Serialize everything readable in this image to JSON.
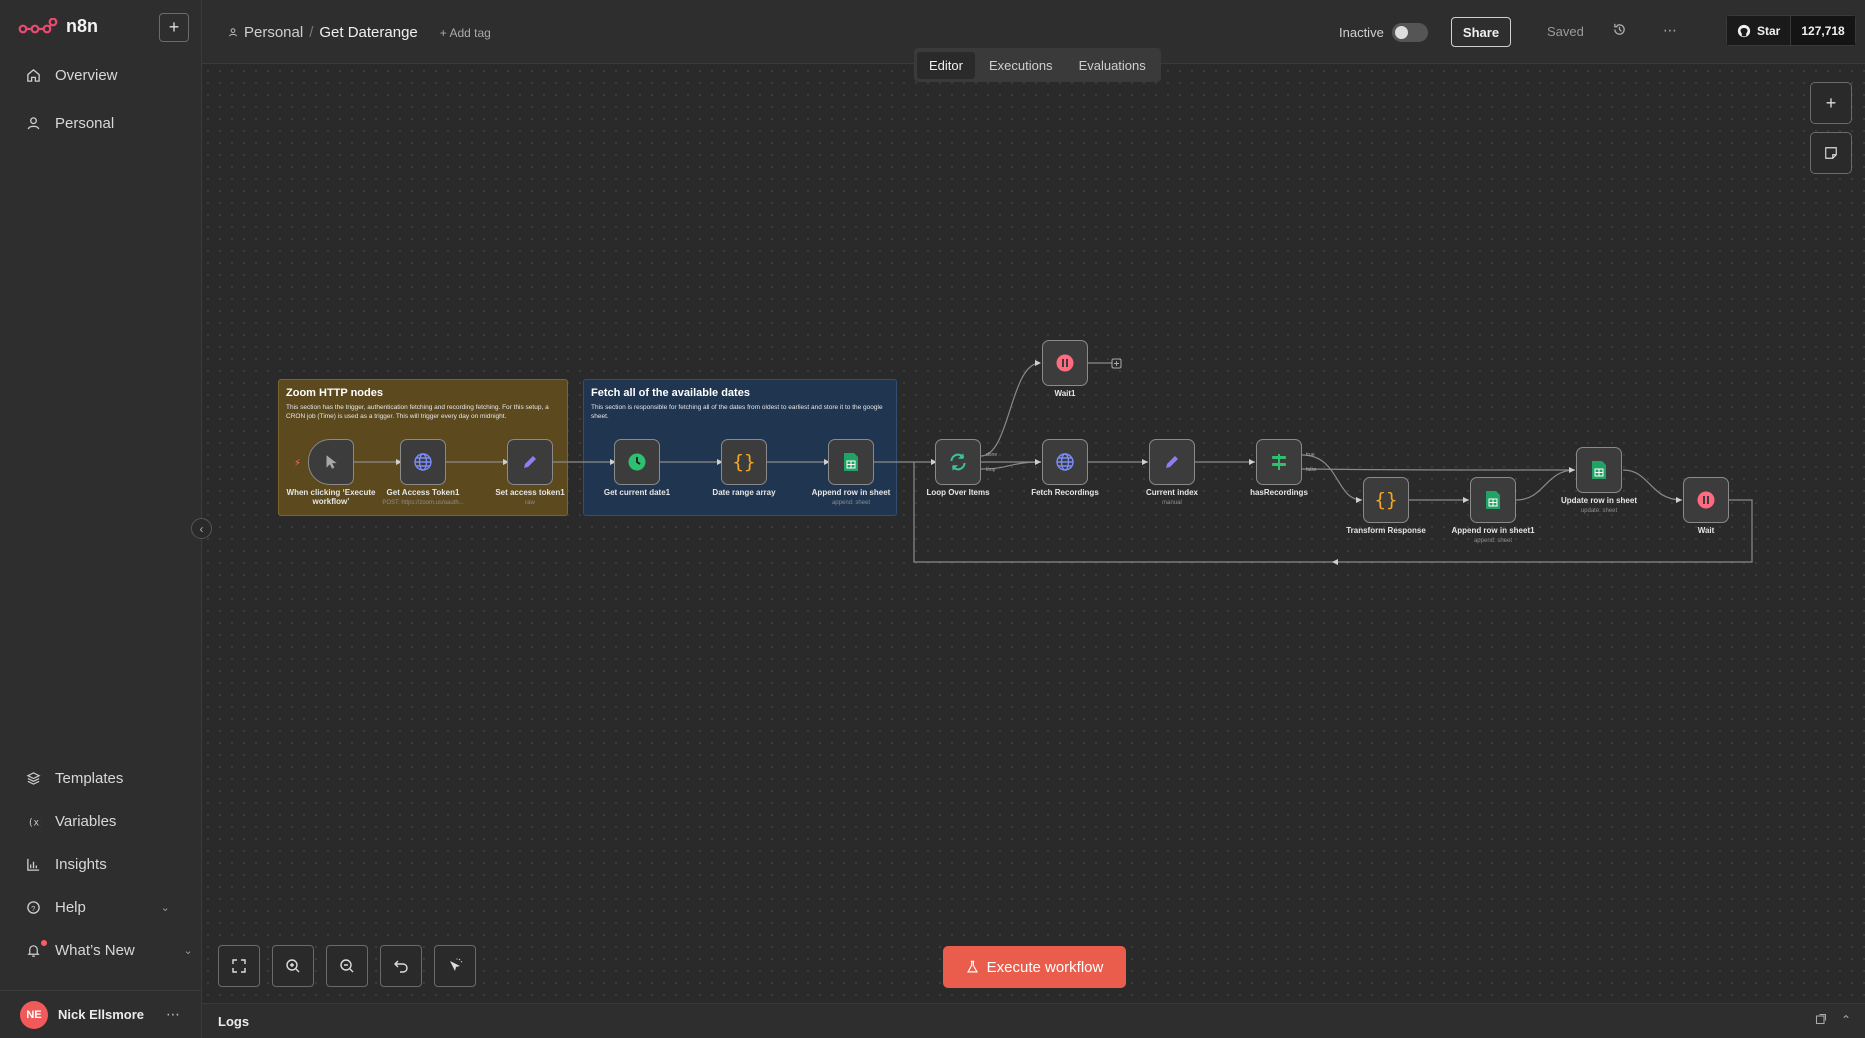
{
  "app": {
    "name": "n8n"
  },
  "sidebar": {
    "items": [
      {
        "label": "Overview",
        "icon": "home-icon"
      },
      {
        "label": "Personal",
        "icon": "user-icon"
      }
    ],
    "bottom_items": [
      {
        "label": "Templates",
        "icon": "templates-icon"
      },
      {
        "label": "Variables",
        "icon": "variables-icon"
      },
      {
        "label": "Insights",
        "icon": "insights-icon"
      },
      {
        "label": "Help",
        "icon": "help-icon"
      },
      {
        "label": "What’s New",
        "icon": "bell-icon"
      }
    ],
    "user": {
      "initials": "NE",
      "name": "Nick Ellsmore"
    }
  },
  "header": {
    "breadcrumb_project": "Personal",
    "workflow_title": "Get Daterange",
    "add_tag": "+ Add tag",
    "status_label": "Inactive",
    "share_label": "Share",
    "saved_label": "Saved",
    "github_star_label": "Star",
    "github_star_count": "127,718"
  },
  "tabs": [
    {
      "label": "Editor",
      "active": true
    },
    {
      "label": "Executions",
      "active": false
    },
    {
      "label": "Evaluations",
      "active": false
    }
  ],
  "stickies": [
    {
      "title": "Zoom HTTP nodes",
      "body": "This section has the trigger, authentication fetching and recording fetching. For this setup, a CRON job (Time) is used as a trigger. This will trigger every day on midnight.",
      "color": "#5c4a1e"
    },
    {
      "title": "Fetch all of the available dates",
      "body": "This section is responsible for fetching all of the dates from oldest to earliest and store it to the google sheet.",
      "color": "#1f3550"
    }
  ],
  "nodes": [
    {
      "id": "trigger",
      "label": "When clicking ‘Execute workflow’",
      "sub": "",
      "icon": "cursor-icon"
    },
    {
      "id": "access_token",
      "label": "Get Access Token1",
      "sub": "POST: https://zoom.us/oauth...",
      "icon": "globe-icon"
    },
    {
      "id": "set_token",
      "label": "Set access token1",
      "sub": "raw",
      "icon": "pencil-icon"
    },
    {
      "id": "current_date",
      "label": "Get current date1",
      "sub": "",
      "icon": "clock-icon"
    },
    {
      "id": "date_range",
      "label": "Date range array",
      "sub": "",
      "icon": "code-icon"
    },
    {
      "id": "append_sheet",
      "label": "Append row in sheet",
      "sub": "append: sheet",
      "icon": "sheets-icon"
    },
    {
      "id": "loop",
      "label": "Loop Over Items",
      "sub": "",
      "icon": "loop-icon"
    },
    {
      "id": "wait1",
      "label": "Wait1",
      "sub": "",
      "icon": "pause-icon"
    },
    {
      "id": "fetch_rec",
      "label": "Fetch Recordings",
      "sub": "",
      "icon": "globe-icon"
    },
    {
      "id": "current_index",
      "label": "Current index",
      "sub": "manual",
      "icon": "pencil-icon"
    },
    {
      "id": "has_rec",
      "label": "hasRecordings",
      "sub": "",
      "icon": "if-icon"
    },
    {
      "id": "transform",
      "label": "Transform Response",
      "sub": "",
      "icon": "code-icon"
    },
    {
      "id": "append_sheet1",
      "label": "Append row in sheet1",
      "sub": "append: sheet",
      "icon": "sheets-icon"
    },
    {
      "id": "update_sheet",
      "label": "Update row in sheet",
      "sub": "update: sheet",
      "icon": "sheets-icon"
    },
    {
      "id": "wait",
      "label": "Wait",
      "sub": "",
      "icon": "pause-icon"
    }
  ],
  "ports": {
    "done": "done",
    "loop": "loop",
    "true": "true",
    "false": "false"
  },
  "execute_button": "Execute workflow",
  "logs": {
    "label": "Logs"
  },
  "colors": {
    "accent": "#ea5d4c",
    "sheets": "#21a366",
    "globe": "#7b8cf7",
    "pencil": "#8b7ef0",
    "clock": "#2fbf71",
    "code": "#f5a623",
    "pause": "#ff6b81"
  }
}
